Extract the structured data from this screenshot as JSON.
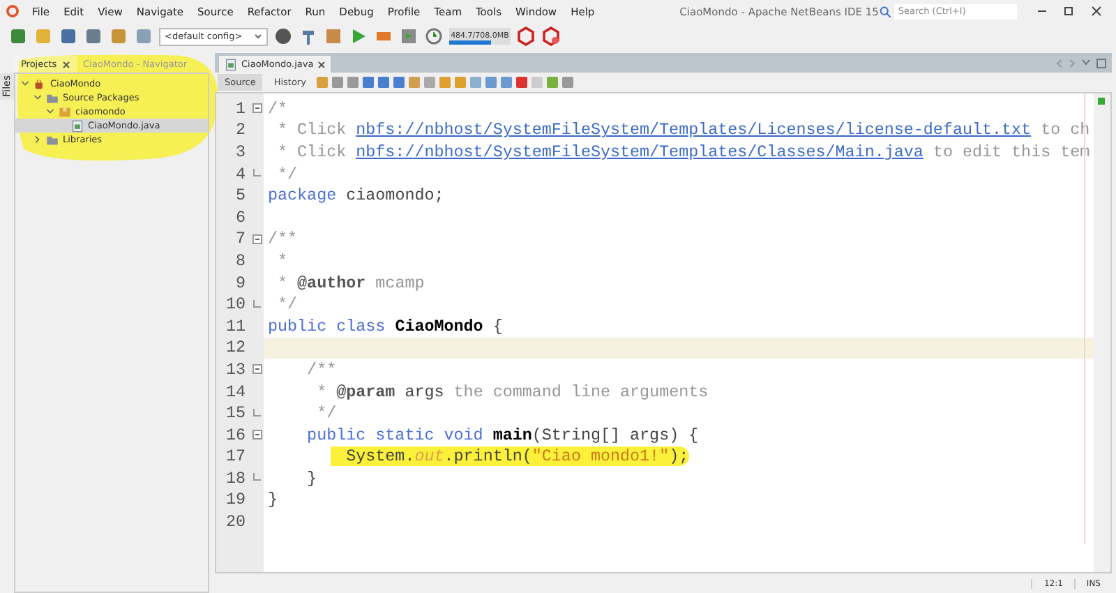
{
  "window": {
    "title": "CiaoMondo - Apache NetBeans IDE 15",
    "search_placeholder": "Search (Ctrl+I)"
  },
  "menu": [
    "File",
    "Edit",
    "View",
    "Navigate",
    "Source",
    "Refactor",
    "Run",
    "Debug",
    "Profile",
    "Team",
    "Tools",
    "Window",
    "Help"
  ],
  "toolbar": {
    "config": "<default config>",
    "memory": {
      "reading": "484.7/708.0MB",
      "level": 0.68
    }
  },
  "side_strip": [
    "Files"
  ],
  "left_tabs": [
    {
      "label": "Projects",
      "selected": true
    },
    {
      "label": "CiaoMondo - Navigator",
      "selected": false
    }
  ],
  "tree": [
    {
      "label": "CiaoMondo",
      "kind": "project",
      "expanded": true,
      "selected": false,
      "children": [
        {
          "label": "Source Packages",
          "kind": "folder",
          "expanded": true,
          "selected": false,
          "children": [
            {
              "label": "ciaomondo",
              "kind": "package",
              "expanded": true,
              "selected": false,
              "children": [
                {
                  "label": "CiaoMondo.java",
                  "kind": "file",
                  "selected": true
                }
              ]
            }
          ]
        },
        {
          "label": "Libraries",
          "kind": "folder",
          "expanded": false,
          "selected": false
        }
      ]
    }
  ],
  "editor_tabs": [
    {
      "label": "CiaoMondo.java",
      "selected": true
    }
  ],
  "view_tabs": [
    {
      "label": "Source",
      "selected": true
    },
    {
      "label": "History",
      "selected": false
    }
  ],
  "lines": [
    {
      "n": "1",
      "fold_start": true,
      "current": false,
      "tokens": [
        {
          "t": "/*",
          "kind": "comment"
        }
      ]
    },
    {
      "n": "2",
      "current": false,
      "tokens": [
        {
          "t": " * Click ",
          "kind": "comment"
        },
        {
          "t": "nbfs://nbhost/SystemFileSystem/Templates/Licenses/license-default.txt",
          "kind": "link"
        },
        {
          "t": " to ch",
          "kind": "comment"
        }
      ]
    },
    {
      "n": "3",
      "current": false,
      "tokens": [
        {
          "t": " * Click ",
          "kind": "comment"
        },
        {
          "t": "nbfs://nbhost/SystemFileSystem/Templates/Classes/Main.java",
          "kind": "link"
        },
        {
          "t": " to edit this tem",
          "kind": "comment"
        }
      ]
    },
    {
      "n": "4",
      "fold_end": true,
      "current": false,
      "tokens": [
        {
          "t": " */",
          "kind": "comment"
        }
      ]
    },
    {
      "n": "5",
      "current": false,
      "tokens": [
        {
          "t": "package",
          "kind": "kw"
        },
        {
          "t": " ciaomondo;",
          "kind": "plain"
        }
      ]
    },
    {
      "n": "6",
      "current": false
    },
    {
      "n": "7",
      "fold_start": true,
      "current": false,
      "tokens": [
        {
          "t": "/**",
          "kind": "comment"
        }
      ]
    },
    {
      "n": "8",
      "current": false,
      "tokens": [
        {
          "t": " *",
          "kind": "comment"
        }
      ]
    },
    {
      "n": "9",
      "current": false,
      "tokens": [
        {
          "t": " * ",
          "kind": "comment"
        },
        {
          "t": "@author",
          "kind": "tag"
        },
        {
          "t": " mcamp",
          "kind": "comment"
        }
      ]
    },
    {
      "n": "10",
      "fold_end": true,
      "current": false,
      "tokens": [
        {
          "t": " */",
          "kind": "comment"
        }
      ]
    },
    {
      "n": "11",
      "current": false,
      "tokens": [
        {
          "t": "public class ",
          "kind": "kw"
        },
        {
          "t": "CiaoMondo",
          "kind": "bold"
        },
        {
          "t": " {",
          "kind": "plain"
        }
      ]
    },
    {
      "n": "12",
      "current": true
    },
    {
      "n": "13",
      "fold_start": true,
      "current": false,
      "tokens": [
        {
          "t": "    /**",
          "kind": "comment"
        }
      ]
    },
    {
      "n": "14",
      "current": false,
      "tokens": [
        {
          "t": "     * ",
          "kind": "comment"
        },
        {
          "t": "@param",
          "kind": "tag"
        },
        {
          "t": " args",
          "kind": "plain"
        },
        {
          "t": " the command line arguments",
          "kind": "comment"
        }
      ]
    },
    {
      "n": "15",
      "fold_end": true,
      "current": false,
      "tokens": [
        {
          "t": "     */",
          "kind": "comment"
        }
      ]
    },
    {
      "n": "16",
      "fold_start": true,
      "current": false,
      "tokens": [
        {
          "t": "    public static void ",
          "kind": "kw"
        },
        {
          "t": "main",
          "kind": "bold"
        },
        {
          "t": "(String[] args) {",
          "kind": "plain"
        }
      ]
    },
    {
      "n": "17",
      "current": false,
      "marked": true,
      "tokens": [
        {
          "t": "        System.",
          "kind": "plain"
        },
        {
          "t": "out",
          "kind": "field"
        },
        {
          "t": ".println(",
          "kind": "plain"
        },
        {
          "t": "\"Ciao mondo1!\"",
          "kind": "string"
        },
        {
          "t": ");",
          "kind": "plain"
        }
      ]
    },
    {
      "n": "18",
      "fold_end": true,
      "current": false,
      "tokens": [
        {
          "t": "    }",
          "kind": "plain"
        }
      ]
    },
    {
      "n": "19",
      "current": false,
      "tokens": [
        {
          "t": "}",
          "kind": "plain"
        }
      ]
    },
    {
      "n": "20",
      "current": false
    }
  ],
  "status_bar": {
    "position": "12:1",
    "mode": "INS"
  }
}
